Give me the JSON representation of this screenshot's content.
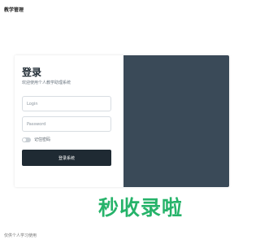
{
  "header": {
    "title": "教学管理"
  },
  "login": {
    "title": "登录",
    "subtitle": "欢迎使用个人教学助理系统",
    "login_placeholder": "Login",
    "password_placeholder": "Password",
    "remember_label": "记住密码",
    "remember_checked": false,
    "submit_label": "登录系统"
  },
  "footer": {
    "text": "仅供个人学习使用"
  },
  "watermark": {
    "text": "秒收录啦"
  },
  "colors": {
    "panel_dark": "#3a4a58",
    "button_dark": "#1f2a33",
    "watermark_green": "#26b36a"
  }
}
